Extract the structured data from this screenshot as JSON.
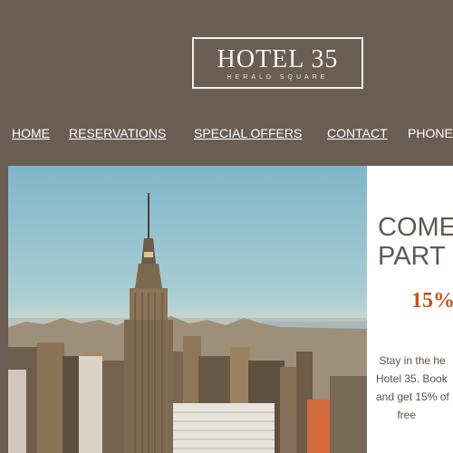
{
  "header": {
    "logo": {
      "name": "HOTEL 35",
      "subtitle": "HERALD SQUARE"
    }
  },
  "nav": {
    "home": "HOME",
    "reservations": "RESERVATIONS",
    "special_offers": "SPECIAL OFFERS",
    "contact": "CONTACT",
    "phone": "PHONE:"
  },
  "hero": {
    "image": "new-york-skyline-empire-state-building"
  },
  "promo": {
    "title": "COME\nPART",
    "discount": "15%",
    "body": " Stay in the he\nHotel 35. Book\nand get 15% of\n       free"
  },
  "colors": {
    "background": "#6a5d54",
    "accent": "#c6531f",
    "panel": "#ffffff"
  }
}
